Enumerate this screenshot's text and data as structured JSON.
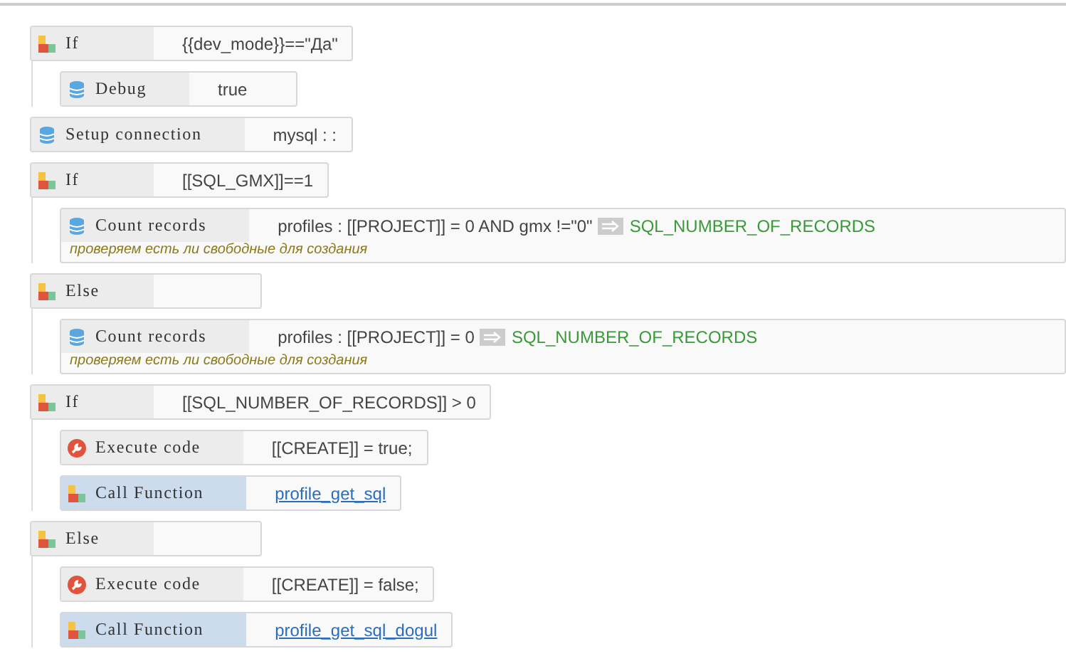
{
  "blocks": [
    {
      "kind": "condition",
      "title": "If",
      "value": "{{dev_mode}}==\"Да\"",
      "children": [
        {
          "kind": "database",
          "title": "Debug",
          "value": "true"
        }
      ]
    },
    {
      "kind": "database",
      "title": "Setup connection",
      "value": "mysql : :"
    },
    {
      "kind": "condition",
      "title": "If",
      "value": "[[SQL_GMX]]==1",
      "children": [
        {
          "kind": "database",
          "title": "Count records",
          "value": "profiles : [[PROJECT]] = 0 AND gmx !=\"0\"",
          "output": "SQL_NUMBER_OF_RECORDS",
          "comment": "проверяем есть ли свободные для создания"
        }
      ]
    },
    {
      "kind": "condition",
      "title": "Else",
      "children": [
        {
          "kind": "database",
          "title": "Count records",
          "value": "profiles : [[PROJECT]] = 0",
          "output": "SQL_NUMBER_OF_RECORDS",
          "comment": "проверяем есть ли свободные для создания"
        }
      ]
    },
    {
      "kind": "condition",
      "title": "If",
      "value": "[[SQL_NUMBER_OF_RECORDS]] > 0",
      "children": [
        {
          "kind": "code",
          "title": "Execute code",
          "value": "[[CREATE]] = true;"
        },
        {
          "kind": "call",
          "title": "Call Function",
          "value": "profile_get_sql"
        }
      ]
    },
    {
      "kind": "condition",
      "title": "Else",
      "children": [
        {
          "kind": "code",
          "title": "Execute code",
          "value": "[[CREATE]] = false;"
        },
        {
          "kind": "call",
          "title": "Call Function",
          "value": "profile_get_sql_dogul"
        }
      ]
    }
  ]
}
